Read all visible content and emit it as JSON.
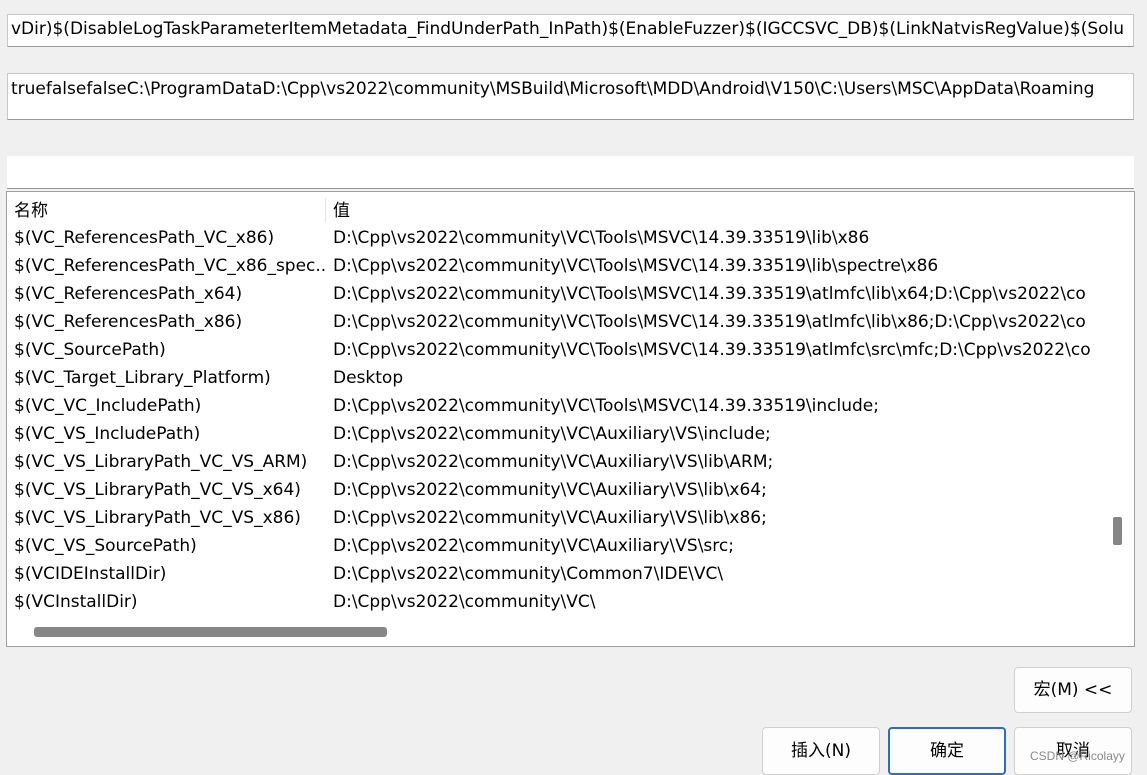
{
  "fields": {
    "evaluated_line1": "vDir)$(DisableLogTaskParameterItemMetadata_FindUnderPath_InPath)$(EnableFuzzer)$(IGCCSVC_DB)$(LinkNatvisRegValue)$(Solu",
    "evaluated_line2": "truefalsefalseC:\\ProgramDataD:\\Cpp\\vs2022\\community\\MSBuild\\Microsoft\\MDD\\Android\\V150\\C:\\Users\\MSC\\AppData\\Roaming",
    "filter_value": ""
  },
  "macro_list": {
    "header_name": "名称",
    "header_value": "值",
    "rows": [
      {
        "name": "$(VC_ReferencesPath_VC_x86)",
        "value": "D:\\Cpp\\vs2022\\community\\VC\\Tools\\MSVC\\14.39.33519\\lib\\x86"
      },
      {
        "name": "$(VC_ReferencesPath_VC_x86_spec...",
        "value": "D:\\Cpp\\vs2022\\community\\VC\\Tools\\MSVC\\14.39.33519\\lib\\spectre\\x86"
      },
      {
        "name": "$(VC_ReferencesPath_x64)",
        "value": "D:\\Cpp\\vs2022\\community\\VC\\Tools\\MSVC\\14.39.33519\\atlmfc\\lib\\x64;D:\\Cpp\\vs2022\\co"
      },
      {
        "name": "$(VC_ReferencesPath_x86)",
        "value": "D:\\Cpp\\vs2022\\community\\VC\\Tools\\MSVC\\14.39.33519\\atlmfc\\lib\\x86;D:\\Cpp\\vs2022\\co"
      },
      {
        "name": "$(VC_SourcePath)",
        "value": "D:\\Cpp\\vs2022\\community\\VC\\Tools\\MSVC\\14.39.33519\\atlmfc\\src\\mfc;D:\\Cpp\\vs2022\\co"
      },
      {
        "name": "$(VC_Target_Library_Platform)",
        "value": "Desktop"
      },
      {
        "name": "$(VC_VC_IncludePath)",
        "value": "D:\\Cpp\\vs2022\\community\\VC\\Tools\\MSVC\\14.39.33519\\include;"
      },
      {
        "name": "$(VC_VS_IncludePath)",
        "value": "D:\\Cpp\\vs2022\\community\\VC\\Auxiliary\\VS\\include;"
      },
      {
        "name": "$(VC_VS_LibraryPath_VC_VS_ARM)",
        "value": "D:\\Cpp\\vs2022\\community\\VC\\Auxiliary\\VS\\lib\\ARM;"
      },
      {
        "name": "$(VC_VS_LibraryPath_VC_VS_x64)",
        "value": "D:\\Cpp\\vs2022\\community\\VC\\Auxiliary\\VS\\lib\\x64;"
      },
      {
        "name": "$(VC_VS_LibraryPath_VC_VS_x86)",
        "value": "D:\\Cpp\\vs2022\\community\\VC\\Auxiliary\\VS\\lib\\x86;"
      },
      {
        "name": "$(VC_VS_SourcePath)",
        "value": "D:\\Cpp\\vs2022\\community\\VC\\Auxiliary\\VS\\src;"
      },
      {
        "name": "$(VCIDEInstallDir)",
        "value": "D:\\Cpp\\vs2022\\community\\Common7\\IDE\\VC\\"
      },
      {
        "name": "$(VCInstallDir)",
        "value": "D:\\Cpp\\vs2022\\community\\VC\\"
      }
    ]
  },
  "buttons": {
    "macro": "宏(M) <<",
    "insert": "插入(N)",
    "ok": "确定",
    "cancel": "取消"
  },
  "watermark": "CSDN @Ricolayy"
}
